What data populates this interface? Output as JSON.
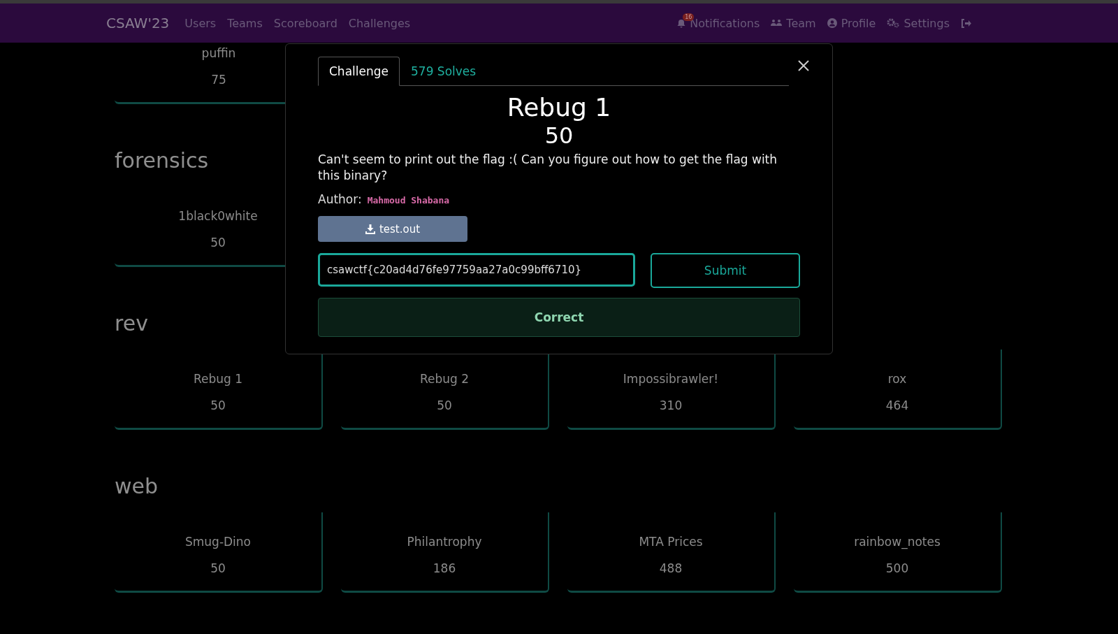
{
  "navbar": {
    "brand": "CSAW'23",
    "links": [
      {
        "label": "Users"
      },
      {
        "label": "Teams"
      },
      {
        "label": "Scoreboard"
      },
      {
        "label": "Challenges"
      }
    ],
    "right_links": [
      {
        "kind": "notifications",
        "label": "Notifications",
        "badge": "16"
      },
      {
        "kind": "team",
        "label": "Team"
      },
      {
        "kind": "profile",
        "label": "Profile"
      },
      {
        "kind": "settings",
        "label": "Settings"
      },
      {
        "kind": "logout"
      }
    ]
  },
  "categories": [
    {
      "challenges": [
        {
          "name": "puffin",
          "value": "75"
        }
      ]
    },
    {
      "name": "forensics",
      "challenges": [
        {
          "name": "1black0white",
          "value": "50"
        }
      ]
    },
    {
      "name": "rev",
      "challenges": [
        {
          "name": "Rebug 1",
          "value": "50"
        },
        {
          "name": "Rebug 2",
          "value": "50"
        },
        {
          "name": "Impossibrawler!",
          "value": "310"
        },
        {
          "name": "rox",
          "value": "464"
        }
      ]
    },
    {
      "name": "web",
      "challenges": [
        {
          "name": "Smug-Dino",
          "value": "50"
        },
        {
          "name": "Philantrophy",
          "value": "186"
        },
        {
          "name": "MTA Prices",
          "value": "488"
        },
        {
          "name": "rainbow_notes",
          "value": "500"
        }
      ]
    }
  ],
  "modal": {
    "tabs": [
      {
        "label": "Challenge",
        "selected": true
      },
      {
        "label": "579 Solves",
        "selected": false
      }
    ],
    "title": "Rebug 1",
    "value": "50",
    "description": "Can't seem to print out the flag :( Can you figure out how to get the flag with this binary?",
    "author_label": "Author:",
    "author": "Mahmoud Shabana",
    "file": "test.out",
    "flag_input": "csawctf{c20ad4d76fe97759aa27a0c99bff6710}",
    "submit": "Submit",
    "result": "Correct"
  }
}
